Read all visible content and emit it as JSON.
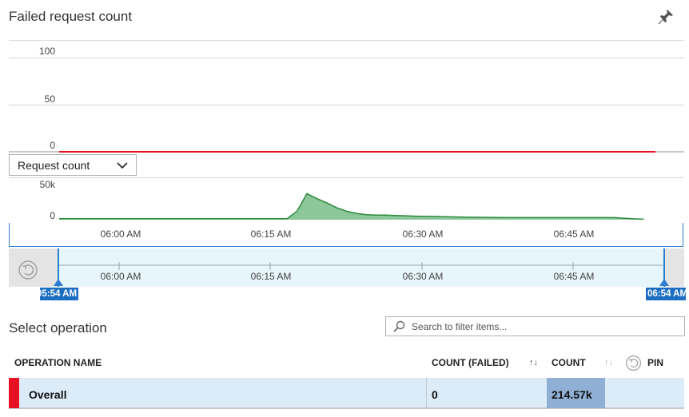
{
  "header": {
    "title": "Failed request count"
  },
  "failed_chart": {
    "yticks": [
      "100",
      "50",
      "0"
    ],
    "series_color": "#e81123"
  },
  "metric_selector": {
    "selected": "Request count"
  },
  "request_chart": {
    "yticks": [
      "50k",
      "0"
    ],
    "xticks": [
      "06:00 AM",
      "06:15 AM",
      "06:30 AM",
      "06:45 AM"
    ],
    "series_color": "#2e8b3e",
    "fill_color": "#8cc79a"
  },
  "navigator": {
    "xticks": [
      "06:00 AM",
      "06:15 AM",
      "06:30 AM",
      "06:45 AM"
    ],
    "start_label": "05:54 AM",
    "end_label": "06:54 AM",
    "accent": "#1b6ec2"
  },
  "operations": {
    "title": "Select operation",
    "search_placeholder": "Search to filter items...",
    "columns": {
      "name": "OPERATION NAME",
      "count_failed": "COUNT (FAILED)",
      "count": "COUNT",
      "pin": "PIN"
    },
    "rows": [
      {
        "name": "Overall",
        "count_failed": "0",
        "count": "214.57k",
        "status_color": "#e81123"
      }
    ]
  },
  "chart_data": [
    {
      "type": "line",
      "title": "Failed request count",
      "xlabel": "",
      "ylabel": "",
      "ylim": [
        0,
        100
      ],
      "yticks": [
        0,
        50,
        100
      ],
      "xticks": [
        "06:00 AM",
        "06:15 AM",
        "06:30 AM",
        "06:45 AM"
      ],
      "x": [
        "05:54",
        "06:54"
      ],
      "series": [
        {
          "values": [
            0,
            0
          ]
        }
      ],
      "grid": true
    },
    {
      "type": "area",
      "title": "Request count",
      "xlabel": "",
      "ylabel": "",
      "ylim": [
        0,
        50000
      ],
      "yticks": [
        0,
        50000
      ],
      "xticks": [
        "06:00 AM",
        "06:15 AM",
        "06:30 AM",
        "06:45 AM"
      ],
      "x": [
        "05:54",
        "06:00",
        "06:15",
        "06:17",
        "06:18",
        "06:19",
        "06:20",
        "06:21",
        "06:22",
        "06:23",
        "06:24",
        "06:25",
        "06:26",
        "06:27",
        "06:28",
        "06:30",
        "06:32",
        "06:35",
        "06:40",
        "06:45",
        "06:50",
        "06:51",
        "06:52",
        "06:53"
      ],
      "series": [
        {
          "values": [
            1500,
            1500,
            1500,
            1500,
            12000,
            37000,
            30000,
            24000,
            17000,
            12000,
            9000,
            7000,
            6500,
            6500,
            6000,
            5000,
            4500,
            3500,
            3000,
            3000,
            3000,
            2200,
            1200,
            700
          ]
        }
      ],
      "grid": false
    }
  ]
}
